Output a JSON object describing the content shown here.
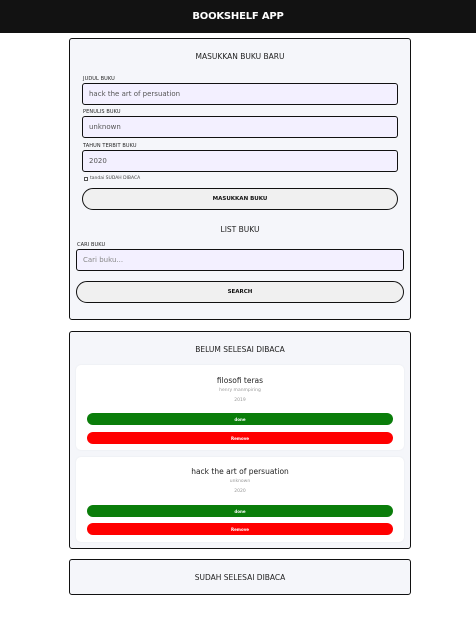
{
  "app": {
    "title": "BOOKSHELF APP"
  },
  "form": {
    "heading": "MASUKKAN BUKU BARU",
    "title_label": "JUDUL BUKU",
    "title_value": "hack the art of persuation",
    "author_label": "PENULIS BUKU",
    "author_value": "unknown",
    "year_label": "TAHUN TERBIT BUKU",
    "year_value": "2020",
    "complete_label": "tandai SUDAH DIBACA",
    "submit_label": "MASUKKAN BUKU"
  },
  "search": {
    "heading": "LIST BUKU",
    "label": "CARI BUKU",
    "placeholder": "Cari buku...",
    "button_label": "SEARCH"
  },
  "unread": {
    "heading": "BELUM SELESAI DIBACA",
    "books": [
      {
        "title": "filosofi teras",
        "author": "henry manmpiring",
        "year": "2019",
        "done_label": "done",
        "remove_label": "Remove"
      },
      {
        "title": "hack the art of persuation",
        "author": "unknown",
        "year": "2020",
        "done_label": "done",
        "remove_label": "Remove"
      }
    ]
  },
  "read": {
    "heading": "SUDAH SELESAI DIBACA"
  },
  "colors": {
    "done": "#0a7d0a",
    "remove": "#ff0000",
    "topbar": "#121212",
    "field_bg": "#f3f0ff"
  }
}
